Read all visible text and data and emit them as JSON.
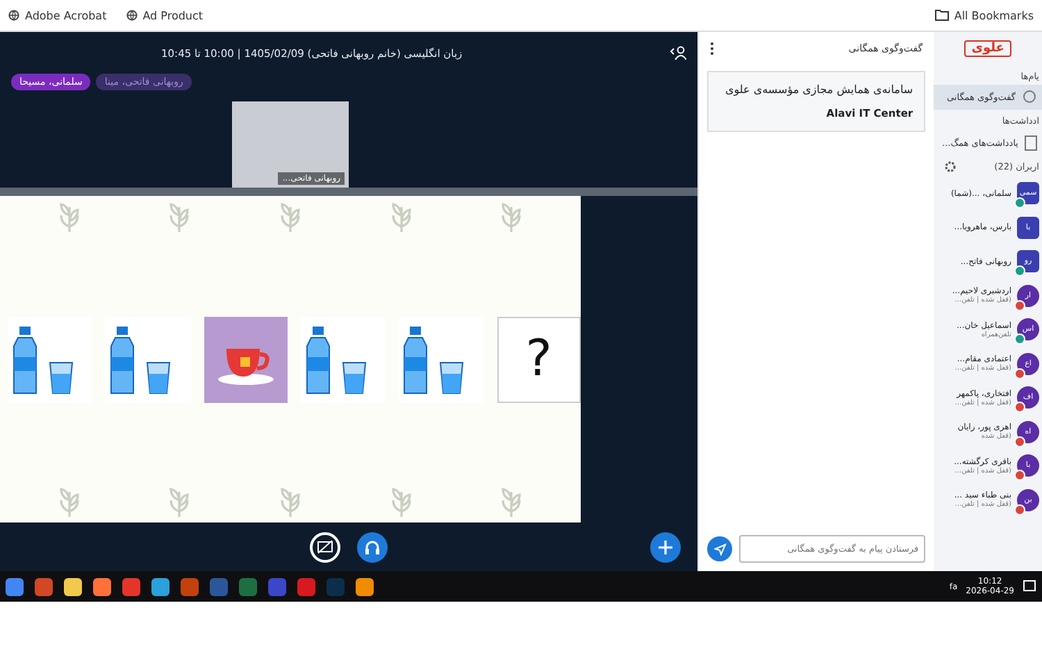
{
  "bookmarks": {
    "pdf_bookmark": "Adobe Acrobat",
    "web_bookmark": "Ad Product",
    "all": "All Bookmarks"
  },
  "meeting": {
    "title": "زبان انگلیسی (خانم روبهانی فاتحی) 1405/02/09 | 10:00 تا 10:45",
    "talkers": [
      {
        "name": "روبهانی فاتحی، مینا",
        "selected": false
      },
      {
        "name": "سلمانی، مسیحا",
        "selected": true
      }
    ],
    "video": {
      "name": "روبهانی فاتحی..."
    }
  },
  "whiteboard": {
    "cards": [
      {
        "kind": "bottle"
      },
      {
        "kind": "bottle"
      },
      {
        "kind": "tea"
      },
      {
        "kind": "bottle"
      },
      {
        "kind": "bottle"
      },
      {
        "kind": "question",
        "text": "?"
      }
    ]
  },
  "chat": {
    "title": "گفت‌وگوی همگانی",
    "welcome": "سامانه‌ی همایش مجازی مؤسسه‌ی علوی",
    "org": "Alavi IT Center",
    "placeholder": "فرستادن پیام به گفت‌وگوی همگانی"
  },
  "sidebar": {
    "logo": "علوی",
    "messages_heading": "یام‌ها",
    "messages": [
      {
        "label": "گفت‌وگوی همگانی",
        "selected": true
      }
    ],
    "notes_heading": "ادداشت‌ها",
    "notes": [
      {
        "label": "یادداشت‌های همگ...",
        "selected": false
      }
    ],
    "users_heading": "اربران (22)",
    "users": [
      {
        "initials": "سمی",
        "name": "سلمانی، ...(شما)",
        "color": "#1a9c8c",
        "kind": "square"
      },
      {
        "initials": "با",
        "name": "بارس، ماهرویا...",
        "kind": "square"
      },
      {
        "initials": "رو",
        "name": "روبهانی فاتح...",
        "color": "#1a9c8c",
        "kind": "square"
      },
      {
        "initials": "ار",
        "name": "اردشیری لاحیم...",
        "status": "(قفل شده | تلفن...",
        "color": "#d9453f",
        "kind": "round"
      },
      {
        "initials": "اس",
        "name": "اسماعیل خان...",
        "status": "تلفن‌همراه",
        "color": "#1a9c8c",
        "kind": "round"
      },
      {
        "initials": "اع",
        "name": "اعتمادی مقام...",
        "status": "(قفل شده | تلفن...",
        "color": "#d9453f",
        "kind": "round"
      },
      {
        "initials": "اف",
        "name": "افتخاری، پاکمهر",
        "status": "(قفل شده | تلفن...",
        "color": "#d9453f",
        "kind": "round"
      },
      {
        "initials": "اه",
        "name": "اهری پور، رایان",
        "status": "(قفل شده",
        "color": "#d9453f",
        "kind": "round"
      },
      {
        "initials": "با",
        "name": "باقری کرگشته...",
        "status": "(قفل شده | تلفن...",
        "color": "#d9453f",
        "kind": "round"
      },
      {
        "initials": "بن",
        "name": "بنی طباء سید ...",
        "status": "(قفل شده | تلفن...",
        "color": "#d9453f",
        "kind": "round"
      }
    ]
  },
  "taskbar": {
    "time": "10:12",
    "date": "2026-04-29",
    "lang": "fa"
  }
}
